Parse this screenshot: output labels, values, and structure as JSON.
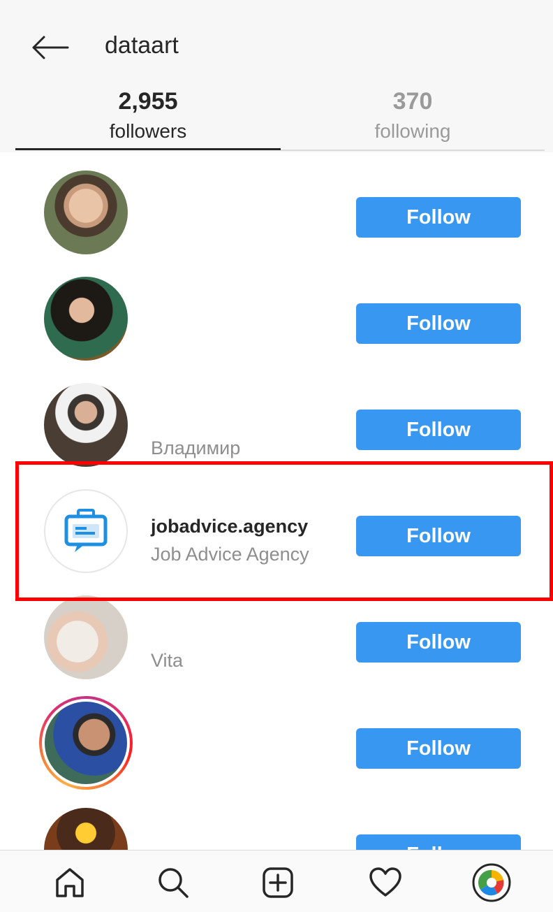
{
  "header": {
    "title": "dataart",
    "back_icon": "arrow-left-icon"
  },
  "tabs": [
    {
      "count": "2,955",
      "label": "followers",
      "active": true
    },
    {
      "count": "370",
      "label": "following",
      "active": false
    }
  ],
  "accent_color": "#3897f0",
  "highlight_color": "#ff0000",
  "rows": [
    {
      "username": "",
      "full_name": "",
      "button_label": "Follow",
      "avatar": "person-photo"
    },
    {
      "username": "",
      "full_name": "",
      "button_label": "Follow",
      "avatar": "person-photo"
    },
    {
      "username": "",
      "full_name": "Владимир",
      "button_label": "Follow",
      "avatar": "person-photo"
    },
    {
      "username": "jobadvice.agency",
      "full_name": "Job Advice Agency",
      "button_label": "Follow",
      "avatar": "briefcase-chat-logo"
    },
    {
      "username": "",
      "full_name": "Vita",
      "button_label": "Follow",
      "avatar": "photo"
    },
    {
      "username": "",
      "full_name": "",
      "button_label": "Follow",
      "avatar": "person-photo-story-ring"
    },
    {
      "username": "",
      "full_name": "",
      "button_label": "Follow",
      "avatar": "photo"
    }
  ],
  "bottom_nav": [
    "home-icon",
    "search-icon",
    "add-post-icon",
    "heart-icon",
    "profile-avatar-icon"
  ]
}
